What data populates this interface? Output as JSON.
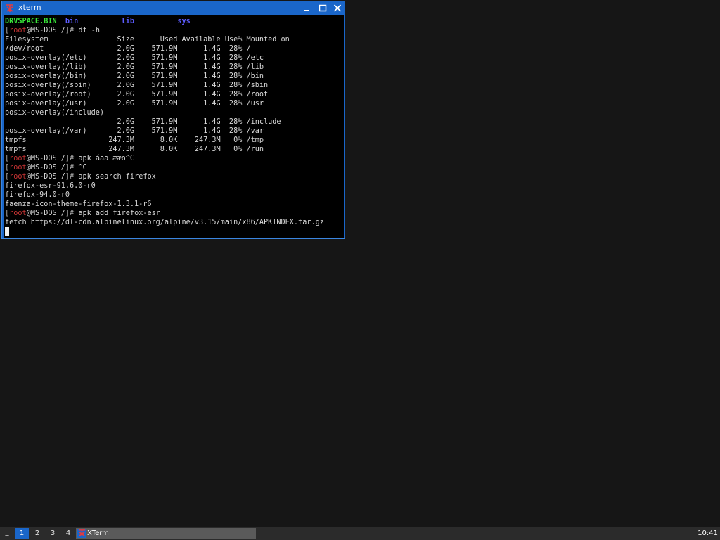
{
  "window": {
    "title": "xterm",
    "minimize_icon": "minimize-icon",
    "maximize_icon": "maximize-icon",
    "close_icon": "close-icon",
    "app_icon": "xterm-icon"
  },
  "terminal": {
    "ls_output": {
      "file": "DRVSPACE.BIN",
      "dirs": [
        "bin",
        "lib",
        "sys"
      ]
    },
    "prompt": {
      "open": "[",
      "user": "root",
      "at": "@",
      "host": "MS-DOS",
      "path": " /",
      "close": "]#"
    },
    "commands": {
      "df": " df -h",
      "apk_garbled": " apk áää ææö^C",
      "ctrl_c": " ^C",
      "apk_search": " apk search firefox",
      "apk_add": " apk add firefox-esr"
    },
    "df_table": [
      "Filesystem                Size      Used Available Use% Mounted on",
      "/dev/root                 2.0G    571.9M      1.4G  28% /",
      "posix-overlay(/etc)       2.0G    571.9M      1.4G  28% /etc",
      "posix-overlay(/lib)       2.0G    571.9M      1.4G  28% /lib",
      "posix-overlay(/bin)       2.0G    571.9M      1.4G  28% /bin",
      "posix-overlay(/sbin)      2.0G    571.9M      1.4G  28% /sbin",
      "posix-overlay(/root)      2.0G    571.9M      1.4G  28% /root",
      "posix-overlay(/usr)       2.0G    571.9M      1.4G  28% /usr",
      "posix-overlay(/include)",
      "                          2.0G    571.9M      1.4G  28% /include",
      "posix-overlay(/var)       2.0G    571.9M      1.4G  28% /var",
      "tmpfs                   247.3M      8.0K    247.3M   0% /tmp",
      "tmpfs                   247.3M      8.0K    247.3M   0% /run"
    ],
    "search_results": [
      "firefox-esr-91.6.0-r0",
      "firefox-94.0-r0",
      "faenza-icon-theme-firefox-1.3.1-r6"
    ],
    "fetch_line": "fetch https://dl-cdn.alpinelinux.org/alpine/v3.15/main/x86/APKINDEX.tar.gz"
  },
  "taskbar": {
    "menu_label": "_",
    "workspaces": [
      "1",
      "2",
      "3",
      "4"
    ],
    "active_workspace": "1",
    "task_label": "XTerm",
    "clock": "10:41",
    "accent": "#1a66c9"
  }
}
